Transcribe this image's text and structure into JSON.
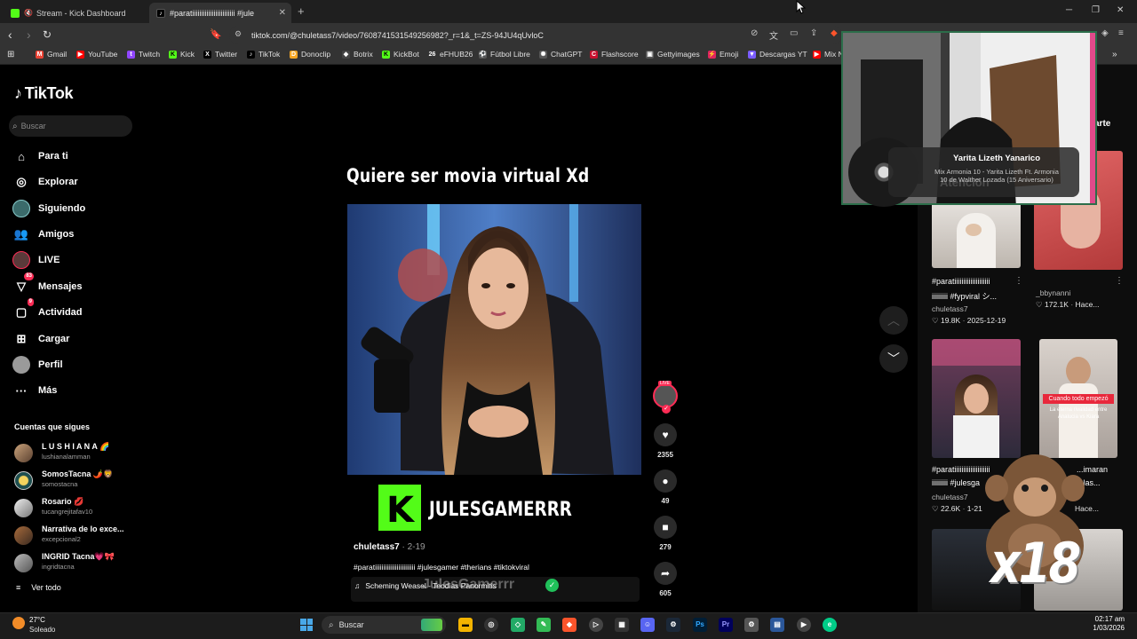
{
  "browser": {
    "tabs": [
      {
        "title": "Stream - Kick Dashboard"
      },
      {
        "title": "#paratiiiiiiiiiiiiiiiiiiiiiiii #jule"
      }
    ],
    "url": "tiktok.com/@chuletass7/video/7608741531549256982?_r=1&_t=ZS-94JU4qUvloC",
    "bookmarks": [
      "Gmail",
      "YouTube",
      "Twitch",
      "Kick",
      "Twitter",
      "TikTok",
      "Donoclip",
      "Botrix",
      "KickBot",
      "eFHUB26",
      "Fútbol Libre",
      "ChatGPT",
      "Flashscore",
      "Gettyimages",
      "Emoji",
      "Descargas YT",
      "Mix N"
    ]
  },
  "tiktok": {
    "logo": "TikTok",
    "search_placeholder": "Buscar",
    "nav": [
      {
        "label": "Para ti",
        "icon": "home-icon"
      },
      {
        "label": "Explorar",
        "icon": "compass-icon"
      },
      {
        "label": "Siguiendo",
        "icon": "following-avatar-icon"
      },
      {
        "label": "Amigos",
        "icon": "friends-icon"
      },
      {
        "label": "LIVE",
        "icon": "live-icon"
      },
      {
        "label": "Mensajes",
        "icon": "messages-icon",
        "badge": "83"
      },
      {
        "label": "Actividad",
        "icon": "activity-icon",
        "badge": "9"
      },
      {
        "label": "Cargar",
        "icon": "upload-icon"
      },
      {
        "label": "Perfil",
        "icon": "profile-icon"
      },
      {
        "label": "Más",
        "icon": "more-icon"
      }
    ],
    "following_title": "Cuentas que sigues",
    "following": [
      {
        "name": "L U S H I A N A 🌈",
        "user": "lushianalamman"
      },
      {
        "name": "SomosTacna 🌶️🦁",
        "user": "somostacna"
      },
      {
        "name": "Rosario 💋",
        "user": "tucangrejitafav10"
      },
      {
        "name": "Narrativa de lo exce...",
        "user": "excepcional2"
      },
      {
        "name": "INGRID Tacna💗🎀",
        "user": "ingridtacna"
      }
    ],
    "see_all": "Ver todo"
  },
  "video": {
    "overlay_title": "Quiere ser movia virtual Xd",
    "kick_name": "JULESGAMERRR",
    "author": "chuletass7",
    "date": "· 2-19",
    "caption": "#paratiiiiiiiiiiiiiiiiiiiiiiii #julesgamer #therians #tiktokviral",
    "music": "Scheming Weasel - Teodias Panormitis",
    "ghost_text": "JulesGamerrr",
    "likes": "2355",
    "comments": "49",
    "saves": "279",
    "shares": "605",
    "live_badge": "LIVE"
  },
  "related": {
    "right_label": "arte",
    "items": [
      {
        "title1": "#paratiiiiiiiiiiiiiiiiiiii",
        "title2": "iiiiiiiii #fypviral シ...",
        "user": "chuletass7",
        "likes": "19.8K",
        "date": "2025-12-19"
      },
      {
        "title1": "_bbynanni",
        "title2": "",
        "user": "",
        "likes": "172.1K",
        "date": "Hace..."
      },
      {
        "title1": "#paratiiiiiiiiiiiiiiiiiiii",
        "title2": "iiiiiiiii #julesga",
        "user": "chuletass7",
        "likes": "22.6K",
        "date": "1-21"
      },
      {
        "title1": "...imaran",
        "title2": "...las...",
        "user": "",
        "likes": "",
        "date": "Hace..."
      }
    ],
    "thumb2_caption": "Cuando todo empezó",
    "thumb2_sub": "La eterna rivalidad entre Analucia vs Kiara"
  },
  "overlay": {
    "artist": "Yarita Lizeth Yanarico",
    "song": "Mix Armonia 10 - Yarita Lizeth Ft. Armonia 10 de Walther Lozada (15 Aniversario)",
    "bg_text": "Atención",
    "sticker": "x18"
  },
  "taskbar": {
    "temp": "27°C",
    "condition": "Soleado",
    "search": "Buscar",
    "time": "02:17 am",
    "date": "1/03/2026"
  },
  "colors": {
    "kick_green": "#53fc18",
    "tiktok_red": "#fe2c55"
  }
}
